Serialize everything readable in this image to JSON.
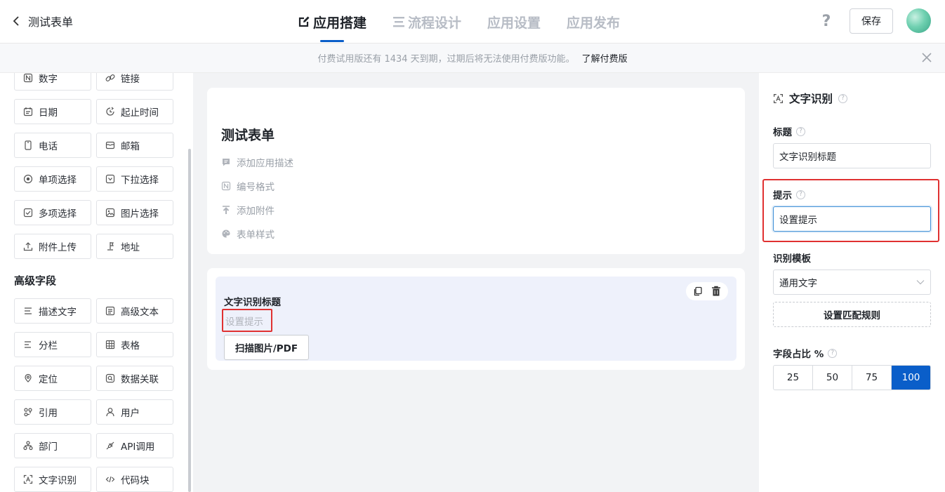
{
  "header": {
    "title": "测试表单",
    "tabs": [
      {
        "label": "应用搭建",
        "icon": "edit-icon"
      },
      {
        "label": "流程设计",
        "icon": "flow-icon"
      },
      {
        "label": "应用设置"
      },
      {
        "label": "应用发布"
      }
    ],
    "help": "?",
    "save_label": "保存"
  },
  "notice": {
    "text": "付费试用版还有 1434 天到期，过期后将无法使用付费版功能。",
    "link": "了解付费版"
  },
  "sidebar": {
    "basic_fields": [
      {
        "label": "数字",
        "icon": "number-icon"
      },
      {
        "label": "链接",
        "icon": "link-icon"
      },
      {
        "label": "日期",
        "icon": "calendar-icon"
      },
      {
        "label": "起止时间",
        "icon": "time-range-icon"
      },
      {
        "label": "电话",
        "icon": "phone-icon"
      },
      {
        "label": "邮箱",
        "icon": "mail-icon"
      },
      {
        "label": "单项选择",
        "icon": "radio-icon"
      },
      {
        "label": "下拉选择",
        "icon": "dropdown-icon"
      },
      {
        "label": "多项选择",
        "icon": "checkbox-icon"
      },
      {
        "label": "图片选择",
        "icon": "image-icon"
      },
      {
        "label": "附件上传",
        "icon": "upload-icon"
      },
      {
        "label": "地址",
        "icon": "location-pin-icon"
      }
    ],
    "advanced_title": "高级字段",
    "advanced_fields": [
      {
        "label": "描述文字",
        "icon": "description-icon"
      },
      {
        "label": "高级文本",
        "icon": "rich-text-icon"
      },
      {
        "label": "分栏",
        "icon": "columns-icon"
      },
      {
        "label": "表格",
        "icon": "table-icon"
      },
      {
        "label": "定位",
        "icon": "locate-icon"
      },
      {
        "label": "数据关联",
        "icon": "data-link-icon"
      },
      {
        "label": "引用",
        "icon": "reference-icon"
      },
      {
        "label": "用户",
        "icon": "user-icon"
      },
      {
        "label": "部门",
        "icon": "department-icon"
      },
      {
        "label": "API调用",
        "icon": "api-icon"
      },
      {
        "label": "文字识别",
        "icon": "ocr-icon"
      },
      {
        "label": "代码块",
        "icon": "code-icon"
      }
    ]
  },
  "form": {
    "title": "测试表单",
    "options": [
      {
        "label": "添加应用描述",
        "icon": "comment-icon"
      },
      {
        "label": "编号格式",
        "icon": "number-format-icon"
      },
      {
        "label": "添加附件",
        "icon": "upload-icon"
      },
      {
        "label": "表单样式",
        "icon": "palette-icon"
      }
    ],
    "field": {
      "title": "文字识别标题",
      "hint": "设置提示",
      "scan_button": "扫描图片/PDF"
    }
  },
  "panel": {
    "heading": "文字识别",
    "title_label": "标题",
    "title_value": "文字识别标题",
    "hint_label": "提示",
    "hint_value": "设置提示",
    "template_label": "识别模板",
    "template_value": "通用文字",
    "rule_button": "设置匹配规则",
    "width_label": "字段占比 %",
    "width_options": [
      "25",
      "50",
      "75",
      "100"
    ],
    "width_selected": "100"
  },
  "colors": {
    "accent": "#0a5ec9",
    "highlight": "#e03131",
    "field_bg": "#eef1fb"
  }
}
